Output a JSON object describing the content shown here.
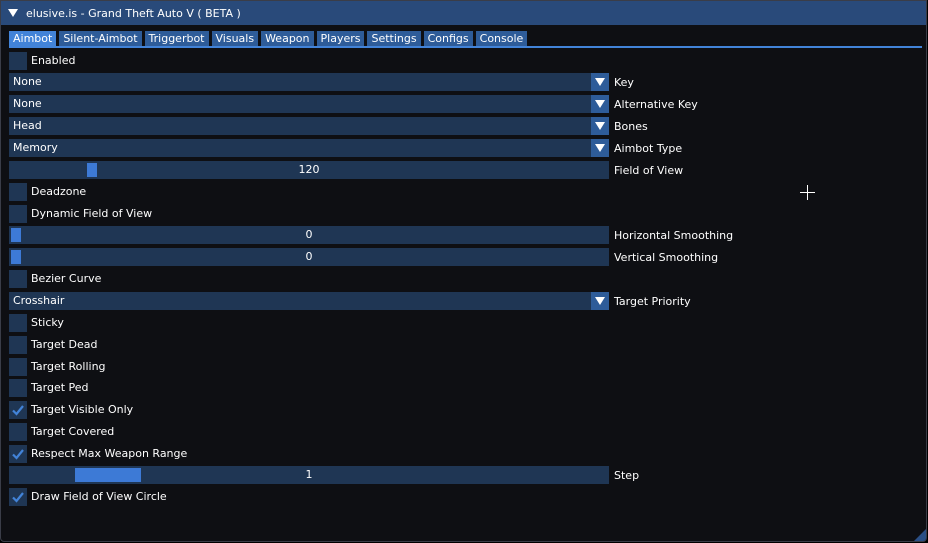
{
  "window": {
    "title": "elusive.is - Grand Theft Auto V ( BETA )"
  },
  "tabs": [
    {
      "label": "Aimbot",
      "active": true
    },
    {
      "label": "Silent-Aimbot",
      "active": false
    },
    {
      "label": "Triggerbot",
      "active": false
    },
    {
      "label": "Visuals",
      "active": false
    },
    {
      "label": "Weapon",
      "active": false
    },
    {
      "label": "Players",
      "active": false
    },
    {
      "label": "Settings",
      "active": false
    },
    {
      "label": "Configs",
      "active": false
    },
    {
      "label": "Console",
      "active": false
    }
  ],
  "aimbot": {
    "enabled": {
      "label": "Enabled",
      "checked": false
    },
    "key": {
      "value": "None",
      "label": "Key"
    },
    "alt_key": {
      "value": "None",
      "label": "Alternative Key"
    },
    "bones": {
      "value": "Head",
      "label": "Bones"
    },
    "aimbot_type": {
      "value": "Memory",
      "label": "Aimbot Type"
    },
    "fov": {
      "value": "120",
      "label": "Field of View",
      "fraction": 0.13
    },
    "deadzone": {
      "label": "Deadzone",
      "checked": false
    },
    "dynamic_fov": {
      "label": "Dynamic Field of View",
      "checked": false
    },
    "h_smoothing": {
      "value": "0",
      "label": "Horizontal Smoothing",
      "fraction": 0.0
    },
    "v_smoothing": {
      "value": "0",
      "label": "Vertical Smoothing",
      "fraction": 0.0
    },
    "bezier": {
      "label": "Bezier Curve",
      "checked": false
    },
    "target_priority": {
      "value": "Crosshair",
      "label": "Target Priority"
    },
    "sticky": {
      "label": "Sticky",
      "checked": false
    },
    "target_dead": {
      "label": "Target Dead",
      "checked": false
    },
    "target_rolling": {
      "label": "Target Rolling",
      "checked": false
    },
    "target_ped": {
      "label": "Target Ped",
      "checked": false
    },
    "target_visible": {
      "label": "Target Visible Only",
      "checked": true
    },
    "target_covered": {
      "label": "Target Covered",
      "checked": false
    },
    "max_range": {
      "label": "Respect Max Weapon Range",
      "checked": true
    },
    "step": {
      "value": "1",
      "label": "Step",
      "fraction": 0.12
    },
    "draw_fov": {
      "label": "Draw Field of View Circle",
      "checked": true
    }
  },
  "colors": {
    "title_bar": "#294a7a",
    "accent": "#4283d8",
    "frame_bg": "#1f3654",
    "window_bg": "#0e0f13"
  }
}
